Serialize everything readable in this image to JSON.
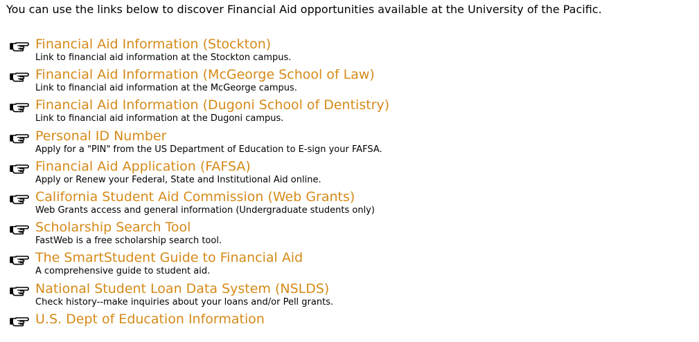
{
  "intro": "You can use the links below to discover Financial Aid opportunities available at the University of the Pacific.",
  "colors": {
    "link": "#d58a18",
    "text": "#000000",
    "background": "#ffffff"
  },
  "icon": "pointing-hand-icon",
  "links": [
    {
      "title": "Financial Aid Information (Stockton)",
      "description": "Link to financial aid information at the Stockton campus."
    },
    {
      "title": "Financial Aid Information (McGeorge School of Law)",
      "description": "Link to financial aid information at the McGeorge campus."
    },
    {
      "title": "Financial Aid Information (Dugoni School of Dentistry)",
      "description": "Link to financial aid information at the Dugoni campus."
    },
    {
      "title": "Personal ID Number",
      "description": "Apply for a \"PIN\" from the US Department of Education to E-sign your FAFSA."
    },
    {
      "title": "Financial Aid Application (FAFSA)",
      "description": "Apply or Renew your Federal, State and Institutional Aid online."
    },
    {
      "title": "California Student Aid Commission (Web Grants)",
      "description": "Web Grants access and general information (Undergraduate students only)"
    },
    {
      "title": "Scholarship Search Tool",
      "description": "FastWeb is a free scholarship search tool."
    },
    {
      "title": "The SmartStudent Guide to Financial Aid",
      "description": "A comprehensive guide to student aid."
    },
    {
      "title": "National Student Loan Data System (NSLDS)",
      "description": "Check history--make inquiries about your loans and/or Pell grants."
    },
    {
      "title": "U.S. Dept of Education Information",
      "description": ""
    }
  ]
}
